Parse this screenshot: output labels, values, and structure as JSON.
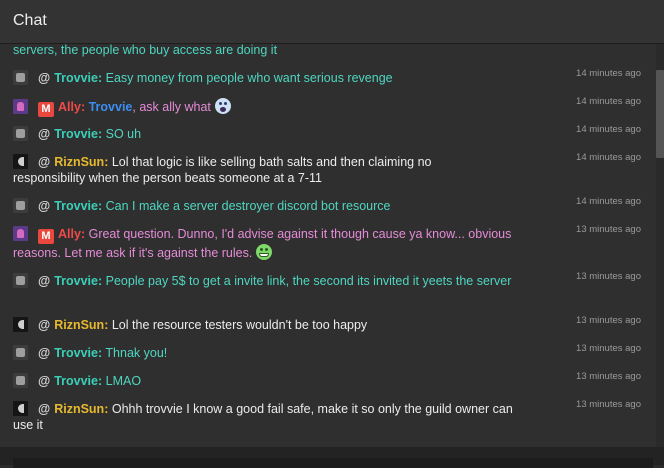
{
  "header": {
    "title": "Chat"
  },
  "partial_top": {
    "text": "servers, the people who buy access are doing it"
  },
  "messages": [
    {
      "user": "Trovvie",
      "text": "Easy money from people who want serious revenge",
      "time": "14 minutes ago"
    },
    {
      "user": "Ally",
      "mention": "Trovvie",
      "text": ", ask ally what",
      "time": "14 minutes ago",
      "badge": "M",
      "emoji": "face-screaming-in-fear"
    },
    {
      "user": "Trovvie",
      "text": "SO uh",
      "time": "14 minutes ago"
    },
    {
      "user": "RiznSun",
      "text": "Lol that logic is like selling bath salts and then claiming no responsibility when the person beats someone at a 7-11",
      "time": "14 minutes ago"
    },
    {
      "user": "Trovvie",
      "text": "Can I make a server destroyer discord bot resource",
      "time": "14 minutes ago"
    },
    {
      "user": "Ally",
      "text": "Great question. Dunno, I'd advise against it though cause ya know... obvious reasons. Let me ask if it's against the rules.",
      "time": "13 minutes ago",
      "badge": "M",
      "emoji": "grinning-face"
    },
    {
      "user": "Trovvie",
      "text": "People pay 5$ to get a invite link, the second its invited it yeets the server",
      "time": "13 minutes ago"
    },
    {
      "user": "RiznSun",
      "text": "Lol the resource testers wouldn't be too happy",
      "time": "13 minutes ago"
    },
    {
      "user": "Trovvie",
      "text": "Thnak you!",
      "time": "13 minutes ago"
    },
    {
      "user": "Trovvie",
      "text": "LMAO",
      "time": "13 minutes ago"
    },
    {
      "user": "RiznSun",
      "text": "Ohhh trovvie I know a good fail safe, make it so only the guild owner can use it",
      "time": "13 minutes ago"
    }
  ],
  "at_symbol": "@",
  "separator": ":",
  "colors": {
    "trovvie": "#3ccfb8",
    "ally": "#f04a4a",
    "riznsun": "#e7b92e",
    "mention": "#3b8ef0",
    "mod_badge": "#e8483e"
  }
}
